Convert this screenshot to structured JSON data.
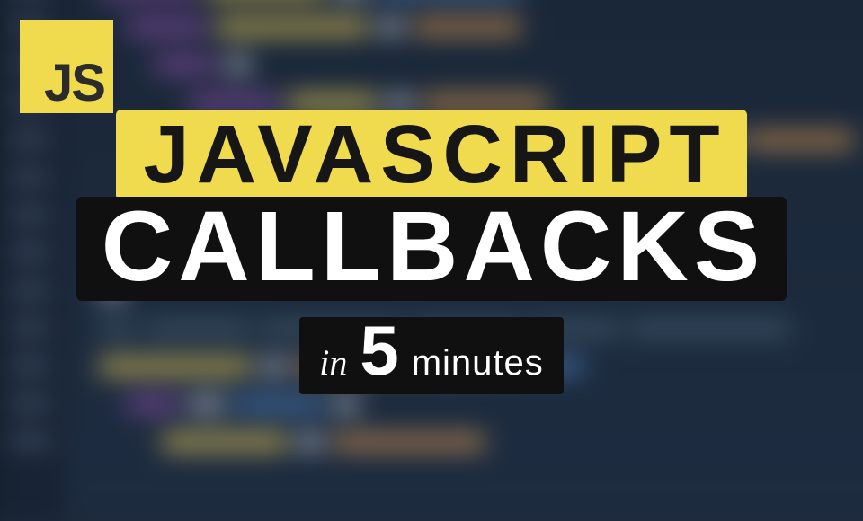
{
  "badge": {
    "label": "JS"
  },
  "title": {
    "line1": "JAVASCRIPT",
    "line2": "CALLBACKS"
  },
  "subtitle": {
    "prefix": "in",
    "number": "5",
    "suffix": "minutes"
  },
  "colors": {
    "yellow": "#f0da4e",
    "dark": "#101010",
    "bg": "#1e2a3a"
  }
}
